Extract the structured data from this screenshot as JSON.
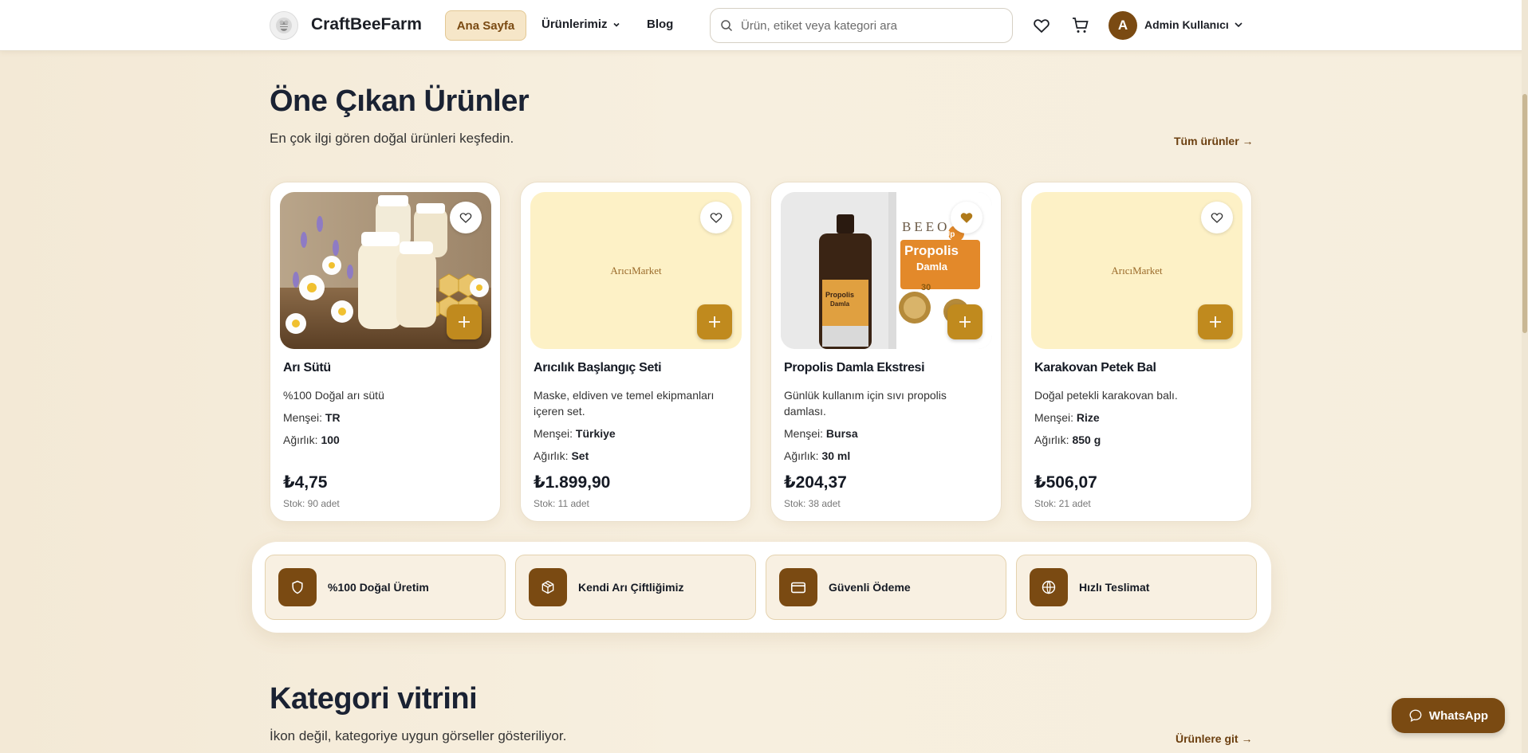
{
  "header": {
    "brand": "CraftBeeFarm",
    "nav": {
      "home": "Ana Sayfa",
      "products": "Ürünlerimiz",
      "blog": "Blog"
    },
    "search_placeholder": "Ürün, etiket veya kategori ara",
    "user": {
      "initial": "A",
      "name": "Admin Kullanıcı"
    }
  },
  "featured": {
    "title": "Öne Çıkan Ürünler",
    "subtitle": "En çok ilgi gören doğal ürünleri keşfedin.",
    "link": "Tüm ürünler →",
    "labels": {
      "origin": "Menşei:",
      "weight": "Ağırlık:"
    },
    "products": [
      {
        "name": "Arı Sütü",
        "desc": "%100 Doğal arı sütü",
        "origin": "TR",
        "weight": "100",
        "price": "₺4,75",
        "stock": "Stok: 90 adet",
        "favorited": false,
        "image": "royal-jelly-photo"
      },
      {
        "name": "Arıcılık Başlangıç Seti",
        "desc": "Maske, eldiven ve temel ekipmanları içeren set.",
        "origin": "Türkiye",
        "weight": "Set",
        "price": "₺1.899,90",
        "stock": "Stok: 11 adet",
        "favorited": false,
        "image": "placeholder",
        "placeholder_text": "ArıcıMarket"
      },
      {
        "name": "Propolis Damla Ekstresi",
        "desc": "Günlük kullanım için sıvı propolis damlası.",
        "origin": "Bursa",
        "weight": "30 ml",
        "price": "₺204,37",
        "stock": "Stok: 38 adet",
        "favorited": true,
        "image": "propolis-photo",
        "package_text": {
          "brand": "BEEO",
          "line": "Up",
          "product": "Propolis",
          "type": "Damla",
          "tag": "30"
        }
      },
      {
        "name": "Karakovan Petek Bal",
        "desc": "Doğal petekli karakovan balı.",
        "origin": "Rize",
        "weight": "850 g",
        "price": "₺506,07",
        "stock": "Stok: 21 adet",
        "favorited": false,
        "image": "placeholder",
        "placeholder_text": "ArıcıMarket"
      }
    ]
  },
  "features": [
    {
      "label": "%100 Doğal Üretim",
      "icon": "shield-icon"
    },
    {
      "label": "Kendi Arı Çiftliğimiz",
      "icon": "box-icon"
    },
    {
      "label": "Güvenli Ödeme",
      "icon": "credit-card-icon"
    },
    {
      "label": "Hızlı Teslimat",
      "icon": "globe-icon"
    }
  ],
  "categories": {
    "title": "Kategori vitrini",
    "subtitle": "İkon değil, kategoriye uygun görseller gösteriliyor.",
    "link": "Ürünlere git →"
  },
  "whatsapp": {
    "label": "WhatsApp"
  },
  "colors": {
    "brand_brown": "#7a4a12",
    "accent_gold": "#c08a1e",
    "favorite_gold": "#b07a1a",
    "background": "#f5ecda"
  }
}
